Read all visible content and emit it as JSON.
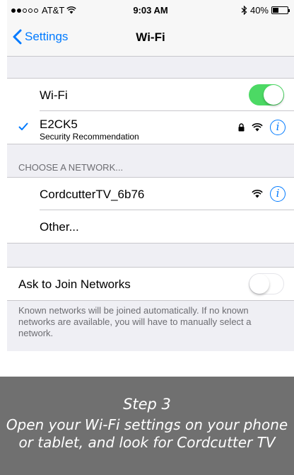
{
  "status": {
    "carrier": "AT&T",
    "time": "9:03 AM",
    "battery": "40%",
    "battery_level": 0.4
  },
  "nav": {
    "back_label": "Settings",
    "title": "Wi-Fi"
  },
  "wifi": {
    "label": "Wi-Fi",
    "enabled": true
  },
  "connected": {
    "name": "E2CK5",
    "subtitle": "Security Recommendation"
  },
  "choose": {
    "header": "CHOOSE A NETWORK...",
    "networks": [
      "CordcutterTV_6b76"
    ],
    "other": "Other..."
  },
  "ask": {
    "label": "Ask to Join Networks",
    "enabled": false,
    "note": "Known networks will be joined automatically. If no known networks are available, you will have to manually select a network."
  },
  "banner": {
    "title": "Step 3",
    "line1": "Open your Wi-Fi settings on your phone",
    "line2": "or tablet, and look for Cordcutter TV"
  },
  "colors": {
    "accent": "#007aff",
    "toggle_on": "#4cd964",
    "banner_bg": "#707070"
  }
}
